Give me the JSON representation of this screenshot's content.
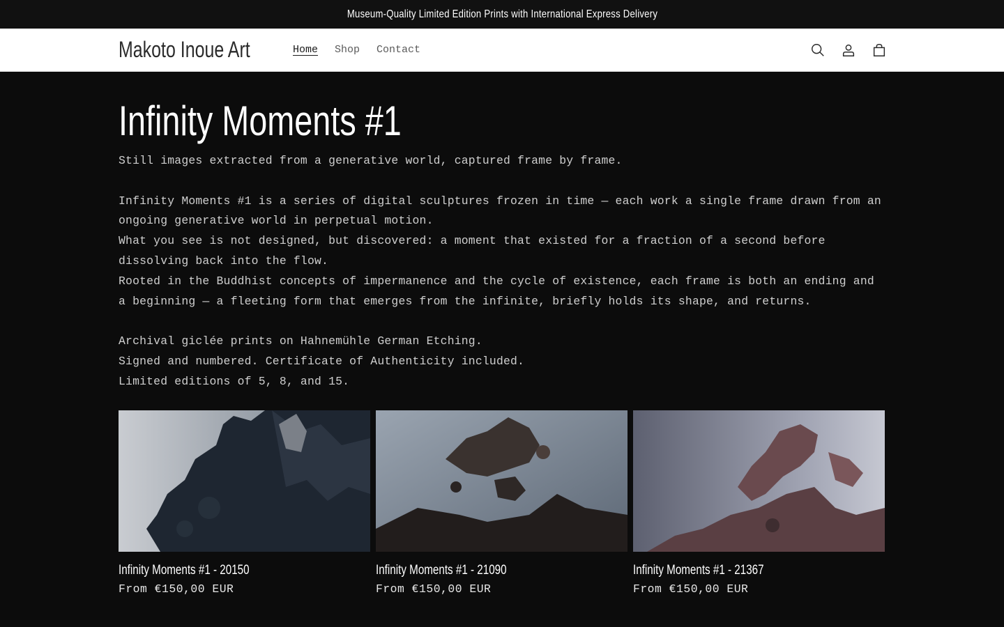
{
  "announcement": {
    "text": "Museum-Quality Limited Edition Prints with International Express Delivery"
  },
  "header": {
    "logo": "Makoto Inoue Art",
    "nav": [
      {
        "label": "Home",
        "active": true
      },
      {
        "label": "Shop",
        "active": false
      },
      {
        "label": "Contact",
        "active": false
      }
    ],
    "icons": [
      "search-icon",
      "account-icon",
      "cart-icon"
    ]
  },
  "collection": {
    "title": "Infinity Moments #1",
    "description": {
      "intro": "Still images extracted from a generative world, captured frame by frame.",
      "p1": "Infinity Moments #1 is a series of digital sculptures frozen in time — each work a single frame drawn from an ongoing generative world in perpetual motion.",
      "p2": "What you see is not designed, but discovered: a moment that existed for a fraction of a second before dissolving back into the flow.",
      "p3": "Rooted in the Buddhist concepts of impermanence and the cycle of existence, each frame is both an ending and a beginning — a fleeting form that emerges from the infinite, briefly holds its shape, and returns.",
      "spec1": "Archival giclée prints on Hahnemühle German Etching.",
      "spec2": "Signed and numbered. Certificate of Authenticity included.",
      "spec3": "Limited editions of 5, 8, and 15."
    },
    "products": [
      {
        "title": "Infinity Moments #1 - 20150",
        "price": "From €150,00 EUR"
      },
      {
        "title": "Infinity Moments #1 - 21090",
        "price": "From €150,00 EUR"
      },
      {
        "title": "Infinity Moments #1 - 21367",
        "price": "From €150,00 EUR"
      }
    ]
  },
  "colors": {
    "background": "#0c0c0c",
    "announcement_bg": "#111111",
    "header_bg": "#ffffff"
  }
}
